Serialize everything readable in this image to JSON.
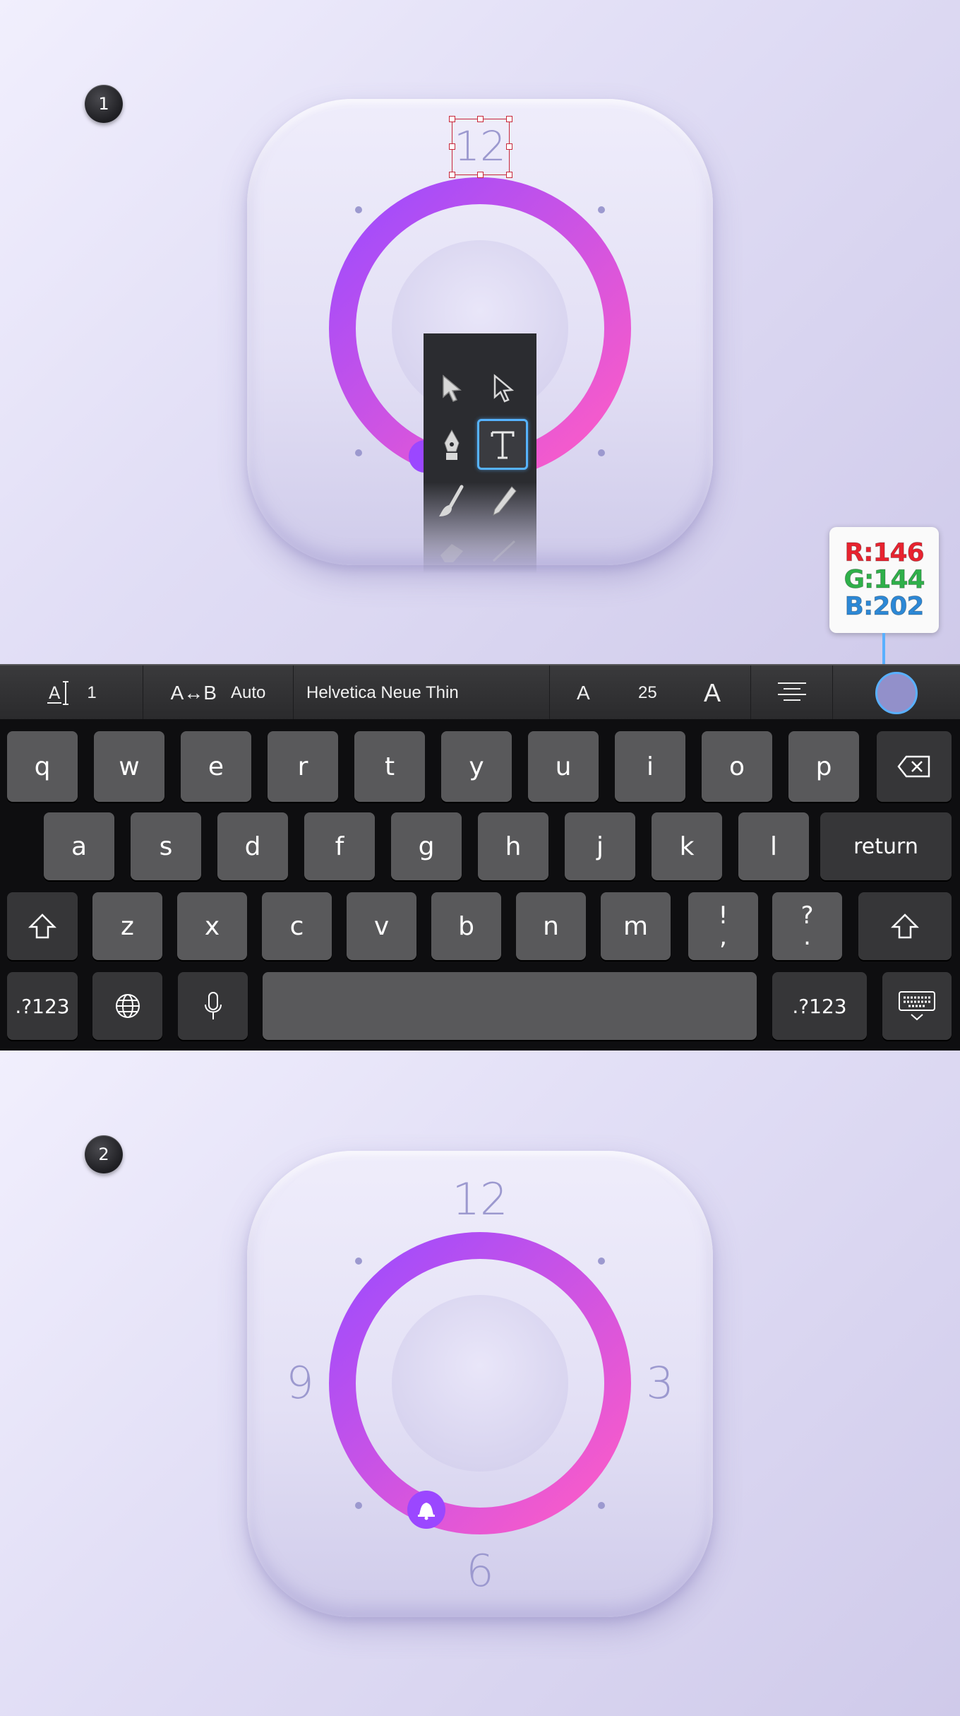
{
  "steps": {
    "step1": "1",
    "step2": "2"
  },
  "step1": {
    "numeral_12": "12"
  },
  "step2": {
    "numeral_12": "12",
    "numeral_3": "3",
    "numeral_6": "6",
    "numeral_9": "9"
  },
  "tools": [
    {
      "name": "selection-arrow-icon"
    },
    {
      "name": "direct-selection-arrow-icon"
    },
    {
      "name": "pen-tool-icon"
    },
    {
      "name": "type-tool-icon",
      "selected": true
    },
    {
      "name": "brush-tool-icon"
    },
    {
      "name": "pencil-tool-icon"
    },
    {
      "name": "eraser-tool-icon"
    },
    {
      "name": "line-tool-icon"
    }
  ],
  "color_readout": {
    "r_label": "R:146",
    "g_label": "G:144",
    "b_label": "B:202",
    "r_color": "#e8232f",
    "g_color": "#2fb04a",
    "b_color": "#2c88d6",
    "swatch_color": "#9290ca"
  },
  "toolbar": {
    "leading_value": "1",
    "tracking_value": "Auto",
    "tracking_icon": "A↔B",
    "font_name": "Helvetica Neue Thin",
    "font_size": "25",
    "size_down_label": "A",
    "size_up_label": "A"
  },
  "keyboard": {
    "row1": [
      "q",
      "w",
      "e",
      "r",
      "t",
      "y",
      "u",
      "i",
      "o",
      "p"
    ],
    "row2": [
      "a",
      "s",
      "d",
      "f",
      "g",
      "h",
      "j",
      "k",
      "l"
    ],
    "row3": [
      "z",
      "x",
      "c",
      "v",
      "b",
      "n",
      "m"
    ],
    "punct1_top": "!",
    "punct1_bottom": ",",
    "punct2_top": "?",
    "punct2_bottom": ".",
    "return_label": "return",
    "numbers_label": ".?123",
    "numbers_label_right": ".?123"
  },
  "colors": {
    "ring_start": "#a04cff",
    "ring_end": "#ff5fc8",
    "numeral": "#9c99cf",
    "dot": "#9c99cf"
  }
}
